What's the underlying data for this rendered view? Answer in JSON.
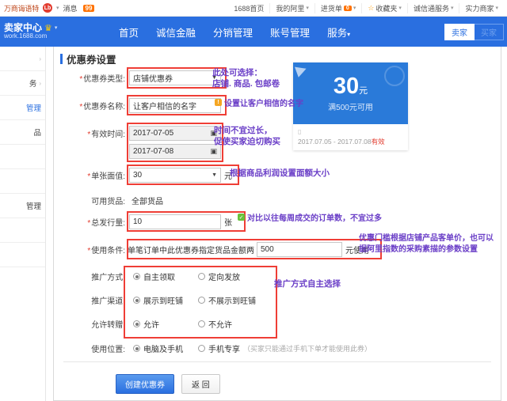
{
  "topbar": {
    "shop_name": "万商诲语特",
    "logo_badge": "Lb",
    "message_label": "消息",
    "message_count": "99",
    "links": [
      {
        "label": "1688首页",
        "caret": false,
        "badge": null
      },
      {
        "label": "我的阿里",
        "caret": true,
        "badge": null
      },
      {
        "label": "进货单",
        "caret": true,
        "badge": "0"
      },
      {
        "label": "收藏夹",
        "caret": true,
        "badge": null,
        "icon": "star-icon"
      },
      {
        "label": "诚信通服务",
        "caret": true,
        "badge": null
      },
      {
        "label": "实力商家",
        "caret": true,
        "badge": null
      }
    ]
  },
  "navbar": {
    "brand_title": "卖家中心",
    "brand_url": "work.1688.com",
    "links": [
      "首页",
      "诚信金融",
      "分销管理",
      "账号管理",
      "服务"
    ],
    "service_caret": "▾",
    "seller_button": "卖家",
    "seller_button_secondary": "买家"
  },
  "sidebar": {
    "items": [
      {
        "label": "",
        "arrow": "›"
      },
      {
        "label": "务",
        "arrow": "›"
      },
      {
        "label": "管理",
        "arrow": "",
        "active": true
      },
      {
        "label": "品",
        "arrow": ""
      },
      {
        "label": "",
        "arrow": ""
      },
      {
        "label": "",
        "arrow": ""
      },
      {
        "label": "管理",
        "arrow": ""
      },
      {
        "label": "",
        "arrow": ""
      },
      {
        "label": "",
        "arrow": ""
      }
    ]
  },
  "panel": {
    "title": "优惠券设置",
    "fields": {
      "coupon_type": {
        "label": "优惠券类型:",
        "value": "店铺优惠券",
        "required": true
      },
      "coupon_name": {
        "label": "优惠券名称:",
        "value": "让客户相信的名字",
        "required": true
      },
      "valid_time": {
        "label": "有效时间:",
        "start": "2017-07-05",
        "end": "2017-07-08",
        "required": true
      },
      "face_value": {
        "label": "单张面值:",
        "value": "30",
        "unit": "元",
        "required": true
      },
      "available_goods": {
        "label": "可用货品:",
        "value": "全部货品"
      },
      "total_issue": {
        "label": "总发行量:",
        "value": "10",
        "unit": "张",
        "required": true
      },
      "use_condition": {
        "label": "使用条件:",
        "prefix": "单笔订单中此优惠券指定货品金额两",
        "value": "500",
        "suffix": "元使用",
        "required": true
      },
      "promote_method": {
        "label": "推广方式:",
        "options": [
          "自主领取",
          "定向发放"
        ],
        "selected": 0
      },
      "promote_channel": {
        "label": "推广渠道:",
        "options": [
          "展示到旺铺",
          "不展示到旺铺"
        ],
        "selected": 0
      },
      "allow_transfer": {
        "label": "允许转赠:",
        "options": [
          "允许",
          "不允许"
        ],
        "selected": 0
      },
      "use_position": {
        "label": "使用位置:",
        "options": [
          "电脑及手机",
          "手机专享"
        ],
        "selected": 0,
        "hint": "（买家只能通过手机下单才能使用此券）"
      }
    },
    "buttons": {
      "submit": "创建优惠券",
      "back": "返 回"
    }
  },
  "coupon_preview": {
    "amount": "30",
    "amount_unit": "元",
    "condition": "满500元可用",
    "date_range": "2017.07.05 - 2017.07.08",
    "valid_suffix": "有效"
  },
  "annotations": [
    {
      "id": "anno-type",
      "text": "此处可选择：\n店铺. 商品. 包邮卷"
    },
    {
      "id": "anno-name",
      "text": "设置让客户相信的名字"
    },
    {
      "id": "anno-time",
      "text": "时间不宜过长，\n促使买家迫切购买"
    },
    {
      "id": "anno-value",
      "text": "根据商品利润设置面额大小"
    },
    {
      "id": "anno-issue",
      "text": "对比以往每周成交的订单数，不宜过多"
    },
    {
      "id": "anno-condition",
      "text": "优惠门槛根据店铺产品客单价，也可以\n据阿里指数的采购素描的参数设置"
    },
    {
      "id": "anno-promote",
      "text": "推广方式自主选择"
    }
  ],
  "colors": {
    "brand_blue": "#2a6fe0",
    "annotation_purple": "#6a3ec7",
    "highlight_red": "#ef3e36",
    "coupon_blue": "#2a7ad9",
    "orange_badge": "#ff7200"
  }
}
